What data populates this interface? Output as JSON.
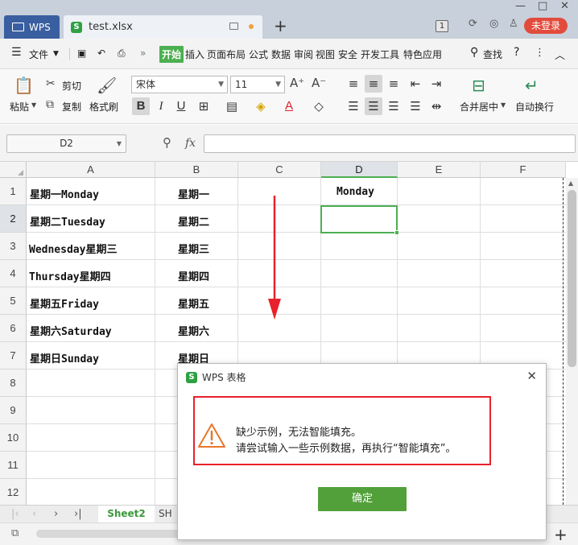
{
  "titlebar": {
    "wps_tab": "WPS",
    "doc_tab": "test.xlsx",
    "new_tab": "+",
    "badge": "1",
    "login": "未登录"
  },
  "menu": {
    "file": "文件",
    "items": [
      "开始",
      "插入",
      "页面布局",
      "公式",
      "数据",
      "审阅",
      "视图",
      "安全",
      "开发工具",
      "特色应用"
    ],
    "search": "查找",
    "help": "?"
  },
  "ribbon": {
    "paste": "粘贴",
    "cut": "剪切",
    "copy": "复制",
    "format_painter": "格式刷",
    "font_name": "宋体",
    "font_size": "11",
    "merge_center": "合并居中",
    "auto_wrap": "自动换行"
  },
  "formula_bar": {
    "name_box": "D2",
    "fx": "fx",
    "formula": ""
  },
  "grid": {
    "columns": [
      "A",
      "B",
      "C",
      "D",
      "E",
      "F"
    ],
    "rows": [
      "1",
      "2",
      "3",
      "4",
      "5",
      "6",
      "7",
      "8",
      "9",
      "10",
      "11",
      "12"
    ],
    "cells": {
      "A1": "星期一Monday",
      "B1": "星期一",
      "D1": "Monday",
      "A2": "星期二Tuesday",
      "B2": "星期二",
      "A3": "Wednesday星期三",
      "B3": "星期三",
      "A4": "Thursday星期四",
      "B4": "星期四",
      "A5": "星期五Friday",
      "B5": "星期五",
      "A6": "星期六Saturday",
      "B6": "星期六",
      "A7": "星期日Sunday",
      "B7": "星期日"
    }
  },
  "sheets": {
    "active": "Sheet2",
    "other": "SH"
  },
  "dialog": {
    "title": "WPS 表格",
    "message_line1": "缺少示例，无法智能填充。",
    "message_line2": "请尝试输入一些示例数据，再执行“智能填充”。",
    "ok": "确定"
  },
  "colors": {
    "accent_green": "#4caf50",
    "dialog_highlight": "#e8222b",
    "arrow_red": "#e8222b",
    "warning_orange": "#e8762b"
  }
}
